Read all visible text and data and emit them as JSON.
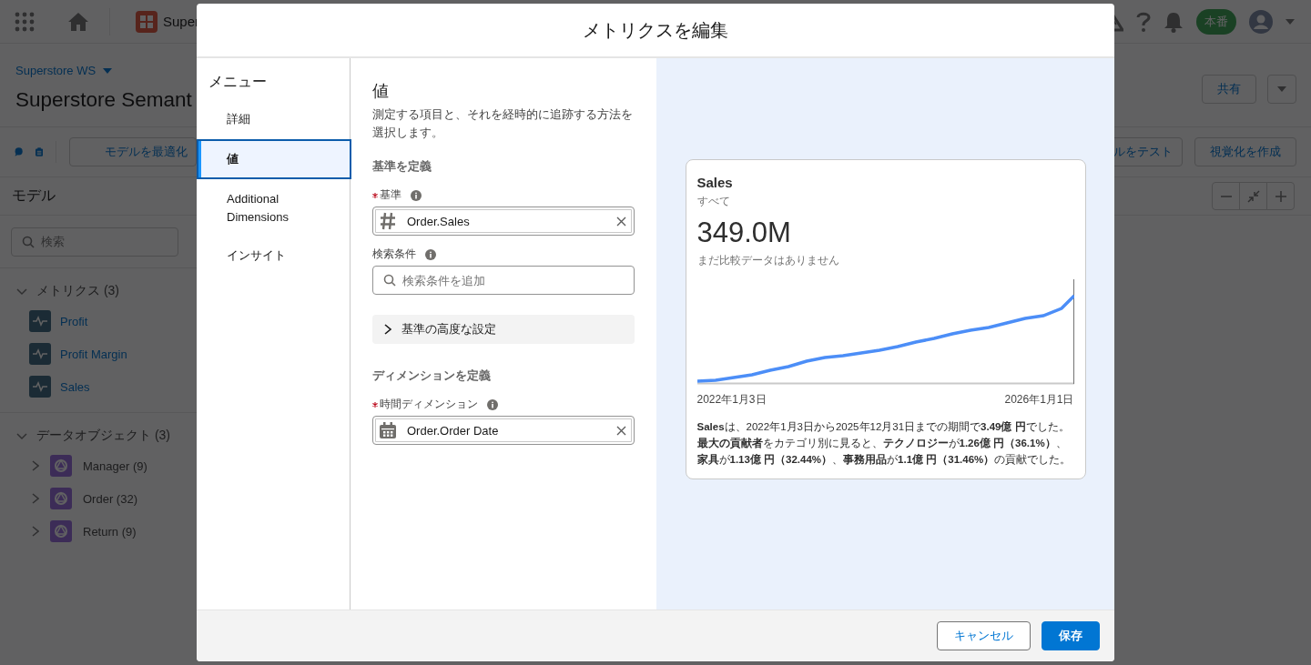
{
  "background": {
    "app_name": "Super",
    "environment_badge": "本番",
    "workspace": "Superstore WS",
    "title": "Superstore Semant",
    "toolbar_buttons": [
      "モデルを最適化"
    ],
    "share_button": "共有",
    "action_buttons": [
      "ルをテスト",
      "視覚化を作成"
    ],
    "panel_title": "モデル",
    "search": {
      "placeholder": "検索"
    },
    "groups": [
      {
        "label": "メトリクス (3)",
        "expanded": true,
        "items": [
          {
            "label": "Profit",
            "kind": "metric"
          },
          {
            "label": "Profit Margin",
            "kind": "metric"
          },
          {
            "label": "Sales",
            "kind": "metric"
          }
        ]
      },
      {
        "label": "データオブジェクト (3)",
        "expanded": true,
        "items": [
          {
            "label": "Manager (9)",
            "kind": "object"
          },
          {
            "label": "Order (32)",
            "kind": "object"
          },
          {
            "label": "Return (9)",
            "kind": "object"
          }
        ]
      }
    ]
  },
  "modal": {
    "title": "メトリクスを編集",
    "menu_title": "メニュー",
    "menu": [
      {
        "label": "詳細",
        "selected": false
      },
      {
        "label": "値",
        "selected": true
      },
      {
        "label": "Additional Dimensions",
        "selected": false
      },
      {
        "label": "インサイト",
        "selected": false
      }
    ],
    "heading": "値",
    "description": "測定する項目と、それを経時的に追跡する方法を選択します。",
    "sections": [
      {
        "title": "基準を定義",
        "fields": [
          {
            "kind": "measure",
            "label": "基準",
            "required": true,
            "value": "Order.Sales"
          },
          {
            "kind": "search",
            "label": "検索条件",
            "required": false,
            "placeholder": "検索条件を追加"
          },
          {
            "kind": "accordion",
            "label": "基準の高度な設定",
            "expanded": false
          }
        ]
      },
      {
        "title": "ディメンションを定義",
        "fields": [
          {
            "kind": "date",
            "label": "時間ディメンション",
            "required": true,
            "value": "Order.Order Date"
          }
        ]
      }
    ],
    "preview": {
      "title": "Sales",
      "subtitle": "すべて",
      "value": "349.0M",
      "comparison": "まだ比較データはありません",
      "x_start": "2022年1月3日",
      "x_end": "2026年1月1日",
      "summary": "**Sales**は、2022年1月3日から2025年12月31日までの期間で**3.49億 円**でした。**最大の貢献者**をカテゴリ別に見ると、**テクノロジー**が**1.26億 円（36.1%）**、**家具**が**1.13億 円（32.44%）**、**事務用品**が**1.1億 円（31.46%）**の貢献でした。"
    },
    "buttons": [
      {
        "label": "キャンセル",
        "kind": "neutral"
      },
      {
        "label": "保存",
        "kind": "brand"
      }
    ]
  }
}
